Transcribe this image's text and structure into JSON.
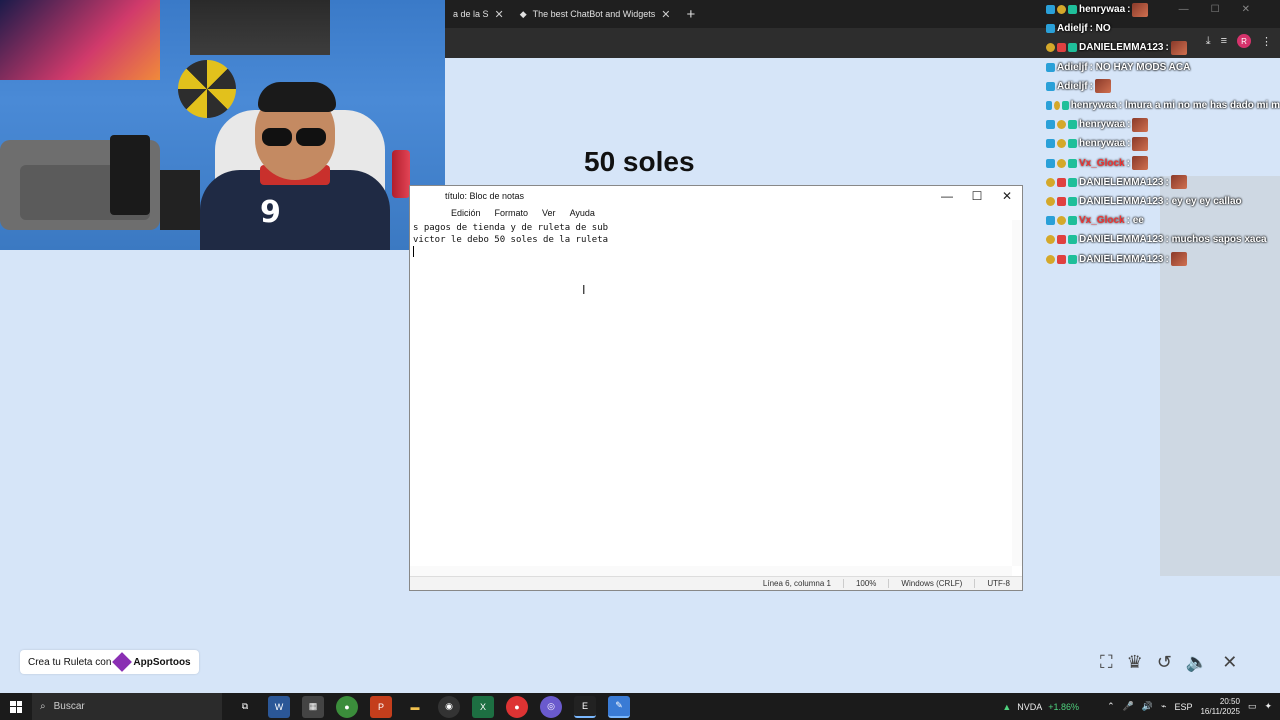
{
  "browser": {
    "tabs": [
      {
        "label": "a de la S"
      },
      {
        "label": "The best ChatBot and Widgets"
      }
    ],
    "new_tab": "+",
    "avatar": "R"
  },
  "page": {
    "headline": "50 soles"
  },
  "notepad": {
    "title": "título: Bloc de notas",
    "menu": [
      "Edición",
      "Formato",
      "Ver",
      "Ayuda"
    ],
    "lines": [
      "s pagos de tienda y de ruleta de sub",
      "",
      "",
      "",
      "victor le debo 50 soles de la ruleta",
      ""
    ],
    "status": {
      "position": "Línea 6, columna 1",
      "zoom": "100%",
      "line_endings": "Windows (CRLF)",
      "encoding": "UTF-8"
    }
  },
  "chat": [
    {
      "name": "henrywaa",
      "msg": ":",
      "badges": [
        "blue",
        "gold",
        "teal"
      ],
      "emote": true,
      "style": "normal"
    },
    {
      "name": "Adieljf",
      "msg": ": NO",
      "badges": [
        "blue"
      ],
      "emote": false,
      "style": "normal"
    },
    {
      "name": "DANIELEMMA123",
      "msg": ":",
      "badges": [
        "gold",
        "red",
        "teal"
      ],
      "emote": true,
      "style": "normal"
    },
    {
      "name": "Adieljf",
      "msg": ": NO HAY MODS ACA",
      "badges": [
        "blue"
      ],
      "emote": false,
      "style": "normal"
    },
    {
      "name": "Adieljf",
      "msg": ":",
      "badges": [
        "blue"
      ],
      "emote": true,
      "style": "normal"
    },
    {
      "name": "henrywaa",
      "msg": ": lmura a mi no me has dado mi m",
      "badges": [
        "blue",
        "gold",
        "teal"
      ],
      "emote": false,
      "style": "normal"
    },
    {
      "name": "henrywaa",
      "msg": ":",
      "badges": [
        "blue",
        "gold",
        "teal"
      ],
      "emote": true,
      "style": "normal"
    },
    {
      "name": "henrywaa",
      "msg": ":",
      "badges": [
        "blue",
        "gold",
        "teal"
      ],
      "emote": true,
      "style": "normal"
    },
    {
      "name": "Vx_Glock",
      "msg": ":",
      "badges": [
        "blue",
        "gold",
        "teal"
      ],
      "emote": true,
      "style": "red"
    },
    {
      "name": "DANIELEMMA123",
      "msg": ":",
      "badges": [
        "gold",
        "red",
        "teal"
      ],
      "emote": true,
      "style": "normal"
    },
    {
      "name": "DANIELEMMA123",
      "msg": ": ey ey ey callao",
      "badges": [
        "gold",
        "red",
        "teal"
      ],
      "emote": false,
      "style": "normal"
    },
    {
      "name": "Vx_Glock",
      "msg": ": ee",
      "badges": [
        "blue",
        "gold",
        "teal"
      ],
      "emote": false,
      "style": "red"
    },
    {
      "name": "DANIELEMMA123",
      "msg": ": muchos sapos xaca",
      "badges": [
        "gold",
        "red",
        "teal"
      ],
      "emote": false,
      "style": "normal"
    },
    {
      "name": "DANIELEMMA123",
      "msg": ":",
      "badges": [
        "gold",
        "red",
        "teal"
      ],
      "emote": true,
      "style": "normal"
    }
  ],
  "promo": {
    "prefix": "Crea tu Ruleta con",
    "brand": "AppSortoos"
  },
  "webcam": {
    "shirt_number": "9"
  },
  "taskbar": {
    "search_placeholder": "Buscar",
    "stock_name": "NVDA",
    "stock_change": "+1.86%",
    "language": "ESP",
    "time": "20:50",
    "date": "16/11/2025"
  },
  "colors": {
    "page_bg": "#d6e5f8",
    "taskbar_bg": "#1b1b1b",
    "accent_green": "#4fd27e"
  }
}
